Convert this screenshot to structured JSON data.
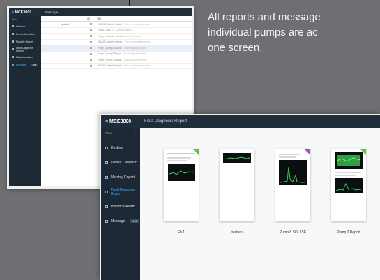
{
  "caption": {
    "line1": "All reports and message",
    "line2": "individual pumps are ac",
    "line3": "one screen."
  },
  "window1": {
    "logo": "≡ MCE3000",
    "tab": "Message",
    "sidebar_header": "Plant",
    "sidebar_collapse": "«",
    "nav": [
      {
        "label": "Desktop",
        "icon": "desktop-icon"
      },
      {
        "label": "Device Condition",
        "icon": "device-icon"
      },
      {
        "label": "Monthly Report",
        "icon": "report-icon"
      },
      {
        "label": "Fault Diagnosis Report",
        "icon": "diagnosis-icon"
      },
      {
        "label": "Historical Alarm",
        "icon": "alarm-icon"
      },
      {
        "label": "Message",
        "icon": "message-icon",
        "badge": "196"
      }
    ],
    "columns": {
      "check": "All",
      "title": "Title"
    },
    "group_label": "Updated",
    "rows": [
      {
        "title": "2018/03 Monthly Report",
        "detail": "This is the monthly report"
      },
      {
        "title": "Pump 2 (SN:...)",
        "detail": "Condition alarm"
      },
      {
        "title": "Pump 1 normal",
        "detail": "Condition back to normal"
      },
      {
        "title": "2018/02 Monthly Report",
        "detail": "This is the monthly report"
      },
      {
        "title": "Pump 2 pump-5 SOLSE",
        "detail": "Fault diagnosis report"
      },
      {
        "title": "Pump 2 pump-5 Report",
        "detail": "Fault diagnosis report"
      },
      {
        "title": "Pump 1 Pump 2 Report",
        "detail": "Fault diagnosis report"
      },
      {
        "title": "2018/01 Monthly Report",
        "detail": "This is the monthly report"
      }
    ]
  },
  "window2": {
    "logo": "≡ MCE3000",
    "tab": "Fault Diagnosis Report",
    "sidebar_header": "Plant",
    "sidebar_collapse": "«",
    "nav": [
      {
        "label": "Desktop",
        "icon": "desktop-icon"
      },
      {
        "label": "Device Condition",
        "icon": "device-icon"
      },
      {
        "label": "Monthly Report",
        "icon": "report-icon"
      },
      {
        "label": "Fault Diagnosis Report",
        "icon": "diagnosis-icon"
      },
      {
        "label": "Historical Alarm",
        "icon": "alarm-icon"
      },
      {
        "label": "Message",
        "icon": "message-icon",
        "badge": "196"
      }
    ],
    "cards": [
      {
        "label": "Fb 1"
      },
      {
        "label": "testrep"
      },
      {
        "label": "Pump 8 SOLLSE"
      },
      {
        "label": "Pump 2 Report"
      }
    ]
  },
  "colors": {
    "background": "#6e6f72",
    "sidebar": "#1d2935",
    "active": "#3fa9f5",
    "tag_green": "#6cbf3a",
    "tag_purple": "#9b59b6"
  }
}
